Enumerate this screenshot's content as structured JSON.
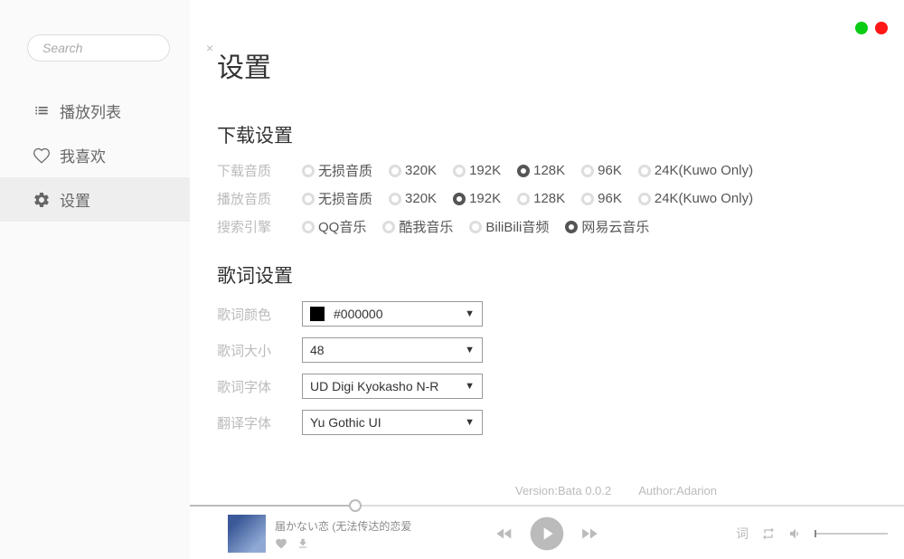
{
  "search": {
    "placeholder": "Search"
  },
  "nav": {
    "playlist": "播放列表",
    "favorites": "我喜欢",
    "settings": "设置"
  },
  "page": {
    "title": "设置"
  },
  "download_section": {
    "title": "下载设置",
    "row1_label": "下载音质",
    "row1_options": [
      "无损音质",
      "320K",
      "192K",
      "128K",
      "96K",
      "24K(Kuwo Only)"
    ],
    "row1_selected": "128K",
    "row2_label": "播放音质",
    "row2_options": [
      "无损音质",
      "320K",
      "192K",
      "128K",
      "96K",
      "24K(Kuwo Only)"
    ],
    "row2_selected": "192K",
    "row3_label": "搜索引擎",
    "row3_options": [
      "QQ音乐",
      "酷我音乐",
      "BiliBili音频",
      "网易云音乐"
    ],
    "row3_selected": "网易云音乐"
  },
  "lyrics_section": {
    "title": "歌词设置",
    "color_label": "歌词颜色",
    "color_value": "#000000",
    "size_label": "歌词大小",
    "size_value": "48",
    "font_label": "歌词字体",
    "font_value": "UD Digi Kyokasho N-R",
    "tfont_label": "翻译字体",
    "tfont_value": "Yu Gothic UI"
  },
  "footer": {
    "version": "Version:Bata 0.0.2",
    "author": "Author:Adarion"
  },
  "player": {
    "song_title": "届かない恋 (无法传达的恋爱",
    "lyrics_btn": "词"
  }
}
